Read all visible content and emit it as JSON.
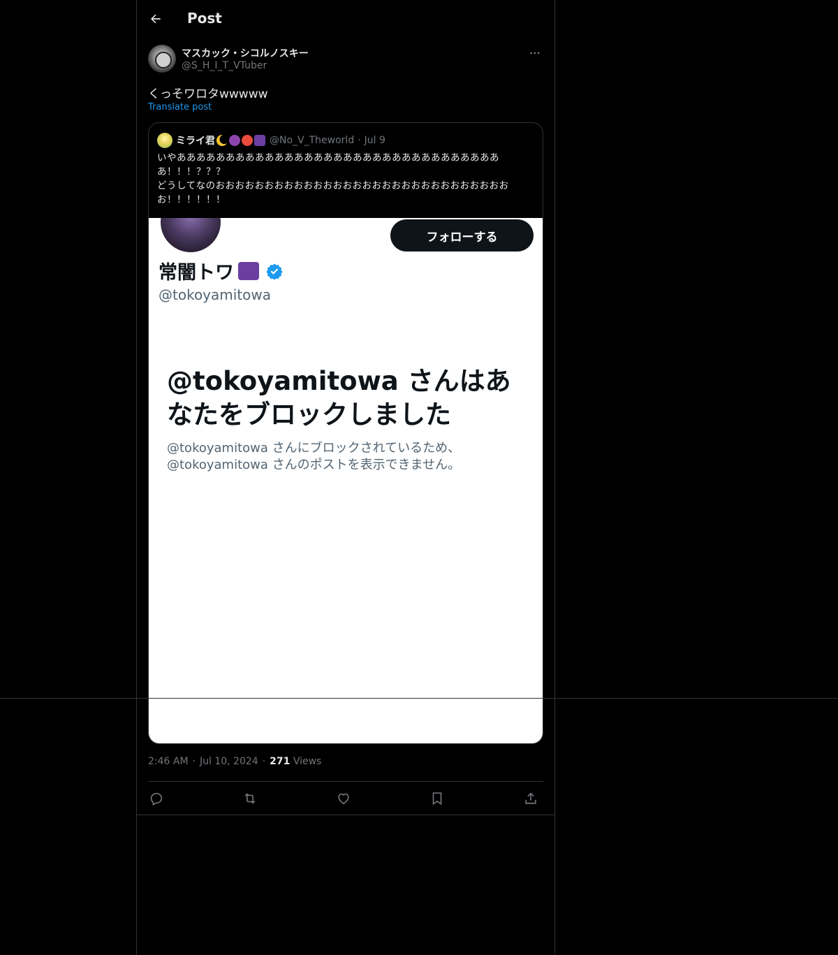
{
  "header": {
    "back_icon": "arrow-left-icon",
    "title": "Post"
  },
  "post": {
    "author_name": "マスカック・シコルノスキー",
    "author_handle": "@S_H_I_T_VTuber",
    "text": "くっそワロタwwwww",
    "translate_label": "Translate post",
    "time": "2:46 AM",
    "date": "Jul 10, 2024",
    "views_count": "271",
    "views_label": "Views"
  },
  "quote": {
    "name": "ミライ君",
    "handle": "@No_V_Theworld",
    "date": "Jul 9",
    "text": "いやああああああああああああああああああああああああああああああああああ！！！？？？\nどうしてなのおおおおおおおおおおおおおおおおおおおおおおおおおおおおおおお！！！！！！",
    "media": {
      "follow_button": "フォローする",
      "profile_name": "常闇トワ",
      "profile_handle": "@tokoyamitowa",
      "blocked_title": "@tokoyamitowa さんはあなたをブロックしました",
      "blocked_desc": "@tokoyamitowa さんにブロックされているため、@tokoyamitowa さんのポストを表示できません。"
    }
  },
  "actions": [
    "reply-icon",
    "repost-icon",
    "like-icon",
    "bookmark-icon",
    "share-icon"
  ],
  "colors": {
    "background": "#000000",
    "text": "#e7e9ea",
    "muted": "#71767b",
    "accent": "#1d9bf0",
    "border": "#2f3336"
  }
}
